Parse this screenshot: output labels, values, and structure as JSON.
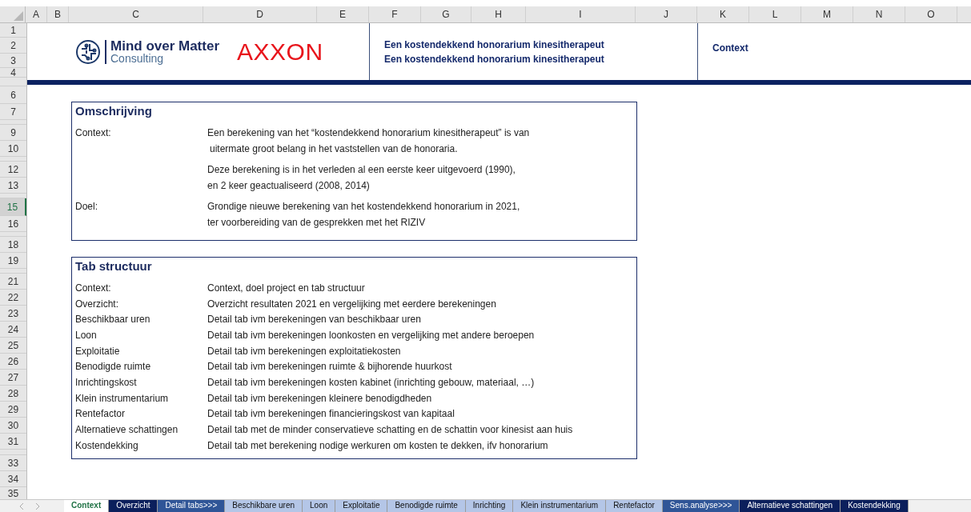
{
  "column_headers": [
    "A",
    "B",
    "C",
    "D",
    "E",
    "F",
    "G",
    "H",
    "I",
    "J",
    "K",
    "L",
    "M",
    "N",
    "O"
  ],
  "row_headers": [
    {
      "label": "1",
      "selected": false
    },
    {
      "label": "2",
      "selected": false
    },
    {
      "label": "3",
      "selected": false
    },
    {
      "label": "4",
      "selected": false
    },
    {
      "label": "6",
      "selected": false
    },
    {
      "label": "7",
      "selected": false
    },
    {
      "label": "9",
      "selected": false
    },
    {
      "label": "10",
      "selected": false
    },
    {
      "label": "12",
      "selected": false
    },
    {
      "label": "13",
      "selected": false
    },
    {
      "label": "15",
      "selected": true
    },
    {
      "label": "16",
      "selected": false
    },
    {
      "label": "18",
      "selected": false
    },
    {
      "label": "19",
      "selected": false
    },
    {
      "label": "21",
      "selected": false
    },
    {
      "label": "22",
      "selected": false
    },
    {
      "label": "23",
      "selected": false
    },
    {
      "label": "24",
      "selected": false
    },
    {
      "label": "25",
      "selected": false
    },
    {
      "label": "26",
      "selected": false
    },
    {
      "label": "27",
      "selected": false
    },
    {
      "label": "28",
      "selected": false
    },
    {
      "label": "29",
      "selected": false
    },
    {
      "label": "30",
      "selected": false
    },
    {
      "label": "31",
      "selected": false
    },
    {
      "label": "33",
      "selected": false
    },
    {
      "label": "34",
      "selected": false
    },
    {
      "label": "35",
      "selected": false
    }
  ],
  "header": {
    "logo": {
      "name": "Mind over Matter",
      "tagline": "Consulting"
    },
    "brand": "AXXON",
    "titles": [
      "Een kostendekkend honorarium kinesitherapeut",
      "Een kostendekkend honorarium kinesitherapeut"
    ],
    "sheet_label": "Context"
  },
  "description": {
    "title": "Omschrijving",
    "groups": [
      {
        "label": "Context:",
        "lines": [
          "Een berekening van het “kostendekkend honorarium kinesitherapeut” is van",
          "uitermate groot belang in het vaststellen van de honoraria."
        ]
      },
      {
        "lines": [
          "Deze berekening is in het verleden al een eerste keer uitgevoerd (1990),",
          "en 2 keer geactualiseerd (2008, 2014)"
        ]
      },
      {
        "label": "Doel:",
        "lines": [
          "Grondige nieuwe berekening van het kostendekkend honorarium in 2021,",
          "ter voorbereiding van de gesprekken met het RIZIV"
        ]
      }
    ]
  },
  "tab_structure": {
    "title": "Tab structuur",
    "rows": [
      {
        "tab": "Context:",
        "description": "Context, doel project en tab structuur"
      },
      {
        "tab": "Overzicht:",
        "description": "Overzicht resultaten 2021 en vergelijking met eerdere berekeningen"
      },
      {
        "tab": "Beschikbaar uren",
        "description": "Detail tab ivm berekeningen van beschikbaar uren"
      },
      {
        "tab": "Loon",
        "description": "Detail tab ivm berekeningen loonkosten en vergelijking met andere beroepen"
      },
      {
        "tab": "Exploitatie",
        "description": "Detail tab ivm berekeningen exploitatiekosten"
      },
      {
        "tab": "Benodigde ruimte",
        "description": "Detail tab ivm berekeningen ruimte & bijhorende huurkost"
      },
      {
        "tab": "Inrichtingskost",
        "description": "Detail tab ivm berekeningen kosten kabinet (inrichting gebouw, materiaal, …)"
      },
      {
        "tab": "Klein instrumentarium",
        "description": "Detail tab ivm berekeningen kleinere benodigdheden"
      },
      {
        "tab": "Rentefactor",
        "description": "Detail tab ivm berekeningen financieringskost van kapitaal"
      },
      {
        "tab": "Alternatieve schattingen",
        "description": "Detail tab met de minder conservatieve schatting en de schattin voor kinesist aan huis"
      },
      {
        "tab": "Kostendekking",
        "description": "Detail tab met berekening nodige werkuren om kosten te dekken, ifv honorarium"
      }
    ]
  },
  "sheet_tabs": [
    {
      "label": "Context",
      "selected": true
    },
    {
      "label": "Overzicht",
      "selected": false,
      "color": "#0b1f5c"
    },
    {
      "label": "Detail tabs>>>",
      "selected": false,
      "color": "#2f5597"
    },
    {
      "label": "Beschikbare uren",
      "selected": false,
      "color": "#b4c6e7"
    },
    {
      "label": "Loon",
      "selected": false,
      "color": "#b4c6e7"
    },
    {
      "label": "Exploitatie",
      "selected": false,
      "color": "#b4c6e7"
    },
    {
      "label": "Benodigde ruimte",
      "selected": false,
      "color": "#b4c6e7"
    },
    {
      "label": "Inrichting",
      "selected": false,
      "color": "#b4c6e7"
    },
    {
      "label": "Klein instrumentarium",
      "selected": false,
      "color": "#b4c6e7"
    },
    {
      "label": "Rentefactor",
      "selected": false,
      "color": "#b4c6e7"
    },
    {
      "label": "Sens.analyse>>>",
      "selected": false,
      "color": "#2f5597"
    },
    {
      "label": "Alternatieve schattingen",
      "selected": false,
      "color": "#0b1f5c"
    },
    {
      "label": "Kostendekking",
      "selected": false,
      "color": "#0b1f5c"
    }
  ]
}
